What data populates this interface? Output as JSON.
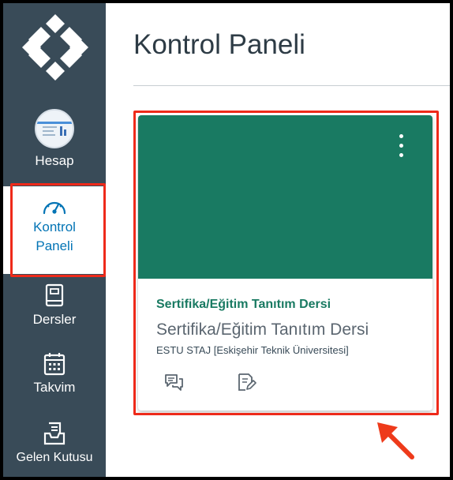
{
  "sidebar": {
    "items": [
      {
        "label": "Hesap",
        "icon": "account-avatar"
      },
      {
        "label_line1": "Kontrol",
        "label_line2": "Paneli",
        "icon": "dashboard-gauge-icon",
        "active": true
      },
      {
        "label": "Dersler",
        "icon": "book-icon"
      },
      {
        "label": "Takvim",
        "icon": "calendar-icon"
      },
      {
        "label": "Gelen Kutusu",
        "icon": "inbox-icon"
      }
    ]
  },
  "main": {
    "title": "Kontrol Paneli",
    "cards": [
      {
        "short_name": "Sertifika/Eğitim Tanıtım Dersi",
        "name": "Sertifika/Eğitim Tanıtım Dersi",
        "term": "ESTU STAJ [Eskişehir Teknik Üniversitesi]",
        "color": "#197a62",
        "actions": [
          "discussions-icon",
          "assignments-icon"
        ]
      }
    ]
  },
  "colors": {
    "sidebar_bg": "#394b58",
    "highlight": "#ee2a1a",
    "active_link": "#0374b5"
  }
}
